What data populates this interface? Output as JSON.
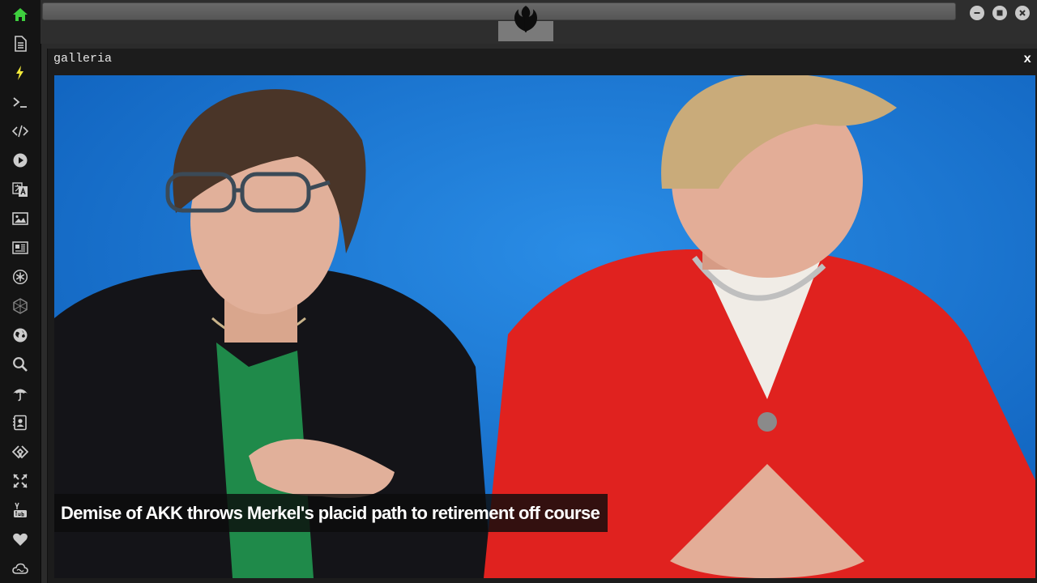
{
  "sidebar": {
    "items": [
      {
        "icon": "home-icon",
        "color": "#3ecf3e"
      },
      {
        "icon": "document-icon",
        "color": "#cccccc"
      },
      {
        "icon": "lightning-icon",
        "color": "#f2e93a"
      },
      {
        "icon": "terminal-icon",
        "color": "#cccccc"
      },
      {
        "icon": "code-icon",
        "color": "#cccccc"
      },
      {
        "icon": "play-icon",
        "color": "#cccccc"
      },
      {
        "icon": "translate-icon",
        "color": "#cccccc"
      },
      {
        "icon": "image-icon",
        "color": "#cccccc"
      },
      {
        "icon": "newspaper-icon",
        "color": "#cccccc"
      },
      {
        "icon": "asterisk-icon",
        "color": "#cccccc"
      },
      {
        "icon": "hexagon-icon",
        "color": "#888888"
      },
      {
        "icon": "globe-icon",
        "color": "#cccccc"
      },
      {
        "icon": "search-icon",
        "color": "#cccccc"
      },
      {
        "icon": "umbrella-icon",
        "color": "#cccccc"
      },
      {
        "icon": "contact-icon",
        "color": "#cccccc"
      },
      {
        "icon": "link-icon",
        "color": "#cccccc"
      },
      {
        "icon": "expand-icon",
        "color": "#cccccc"
      },
      {
        "icon": "youtube-icon",
        "color": "#cccccc"
      },
      {
        "icon": "heart-icon",
        "color": "#cccccc"
      },
      {
        "icon": "cloud-icon",
        "color": "#cccccc"
      }
    ]
  },
  "topbar": {
    "logo_icon": "rebel-alliance-icon",
    "window_controls": [
      "minimize-icon",
      "maximize-icon",
      "close-icon"
    ]
  },
  "gallery": {
    "title": "galleria",
    "close_label": "x",
    "caption": "Demise of AKK throws Merkel's placid path to retirement off course"
  },
  "colors": {
    "accent_green": "#3ecf3e",
    "accent_yellow": "#f2e93a",
    "photo_background": "#1a78d0"
  }
}
